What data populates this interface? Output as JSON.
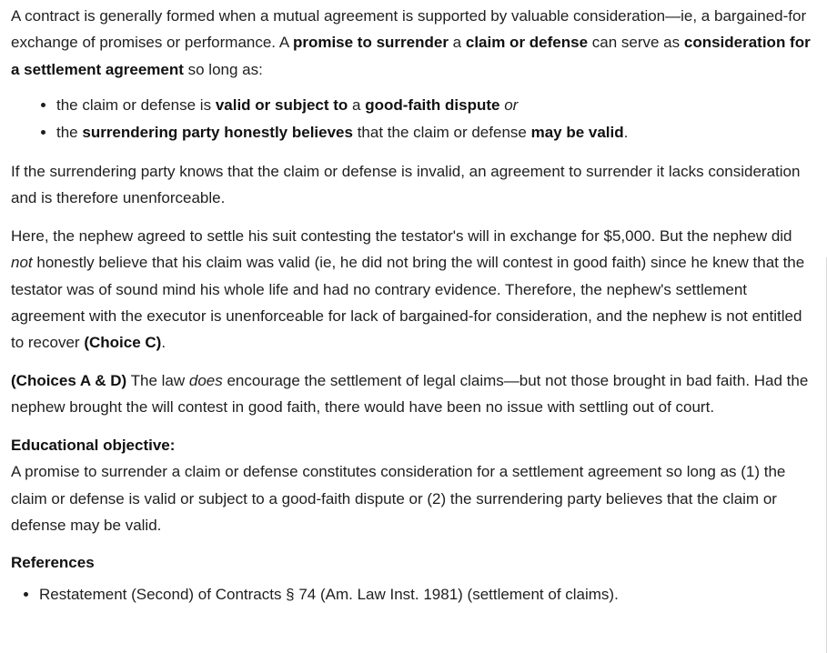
{
  "p1": {
    "t1": "A contract is generally formed when a mutual agreement is supported by valuable consideration—ie, a bargained-for exchange of promises or performance.  A ",
    "b1": "promise to surrender",
    "t2": " a ",
    "b2": "claim or defense",
    "t3": " can serve as ",
    "b3": "consideration for a settlement agreement",
    "t4": " so long as:"
  },
  "bullets": {
    "item1": {
      "t1": "the claim or defense is ",
      "b1": "valid or subject to",
      "t2": " a ",
      "b2": "good-faith dispute",
      "t3": " ",
      "i1": "or"
    },
    "item2": {
      "t1": "the ",
      "b1": "surrendering party honestly believes",
      "t2": " that the claim or defense ",
      "b2": "may be valid",
      "t3": "."
    }
  },
  "p2": {
    "text": "If the surrendering party knows that the claim or defense is invalid, an agreement to surrender it lacks consideration and is therefore unenforceable."
  },
  "p3": {
    "t1": "Here, the nephew agreed to settle his suit contesting the testator's will in exchange for $5,000.  But the nephew did ",
    "i1": "not",
    "t2": " honestly believe that his claim was valid (ie, he did not bring the will contest in good faith) since he knew that the testator was of sound mind his whole life and had no contrary evidence.  Therefore, the nephew's settlement agreement with the executor is unenforceable for lack of bargained-for consideration, and the nephew is not entitled to recover ",
    "b1": "(Choice C)",
    "t3": "."
  },
  "p4": {
    "b1": "(Choices A & D)",
    "t1": "  The law ",
    "i1": "does",
    "t2": " encourage the settlement of legal claims—but not those brought in bad faith.  Had the nephew brought the will contest in good faith, there would have been no issue with settling out of court."
  },
  "objective": {
    "heading": "Educational objective:",
    "text": "A promise to surrender a claim or defense constitutes consideration for a settlement agreement so long as (1) the claim or defense is valid or subject to a good-faith dispute or (2) the surrendering party believes that the claim or defense may be valid."
  },
  "references": {
    "heading": "References",
    "items": [
      "Restatement (Second) of Contracts § 74 (Am. Law Inst. 1981) (settlement of claims)."
    ]
  }
}
